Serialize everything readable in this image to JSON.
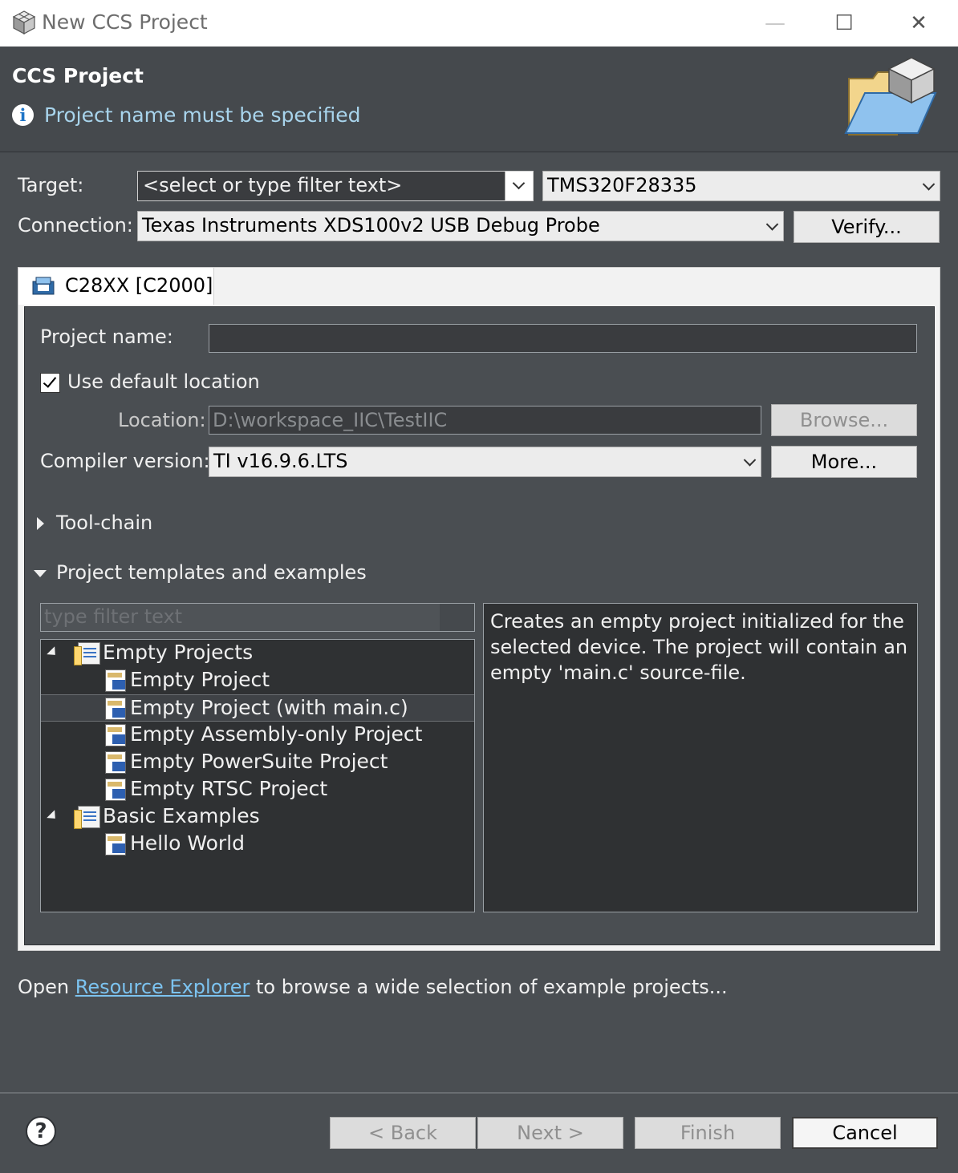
{
  "window": {
    "title": "New CCS Project",
    "minimize_glyph": "—",
    "maximize_glyph": "☐",
    "close_glyph": "✕"
  },
  "banner": {
    "title": "CCS Project",
    "message": "Project name must be specified"
  },
  "target": {
    "label": "Target:",
    "filter_placeholder": "<select or type filter text>",
    "device_value": "TMS320F28335"
  },
  "connection": {
    "label": "Connection:",
    "value": "Texas Instruments XDS100v2 USB Debug Probe",
    "verify_label": "Verify..."
  },
  "tab": {
    "label": "C28XX [C2000]"
  },
  "form": {
    "project_name_label": "Project name:",
    "project_name_value": "",
    "use_default_label": "Use default location",
    "use_default_checked": true,
    "location_label": "Location:",
    "location_value": "D:\\workspace_IIC\\TestIIC",
    "browse_label": "Browse...",
    "compiler_label": "Compiler version:",
    "compiler_value": "TI v16.9.6.LTS",
    "more_label": "More...",
    "toolchain_label": "Tool-chain",
    "templates_label": "Project templates and examples",
    "filter_placeholder": "type filter text"
  },
  "tree": [
    {
      "label": "Empty Projects",
      "kind": "folder"
    },
    {
      "label": "Empty Project",
      "kind": "project"
    },
    {
      "label": "Empty Project (with main.c)",
      "kind": "project",
      "selected": true
    },
    {
      "label": "Empty Assembly-only Project",
      "kind": "project"
    },
    {
      "label": "Empty PowerSuite Project",
      "kind": "project"
    },
    {
      "label": "Empty RTSC Project",
      "kind": "project"
    },
    {
      "label": "Basic Examples",
      "kind": "folder"
    },
    {
      "label": "Hello World",
      "kind": "project"
    }
  ],
  "description": "Creates an empty project initialized for the selected device. The project will contain an empty 'main.c' source-file.",
  "footer_text": {
    "before": "Open ",
    "link": "Resource Explorer",
    "after": " to browse a wide selection of example projects..."
  },
  "buttons": {
    "help_glyph": "?",
    "back": "< Back",
    "next": "Next >",
    "finish": "Finish",
    "cancel": "Cancel"
  },
  "colors": {
    "background": "#4a4e52",
    "link": "#7cc3f0",
    "info_message": "#a8d4ec"
  }
}
